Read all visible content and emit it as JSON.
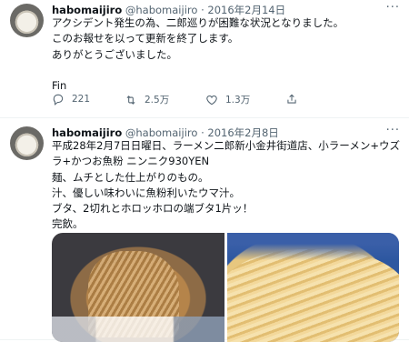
{
  "tweets": [
    {
      "name": "habomaijiro",
      "handle": "@habomaijiro",
      "dot": "·",
      "date": "2016年2月14日",
      "more": "···",
      "lines": [
        "アクシデント発生の為、二郎巡りが困難な状況となりました。",
        "このお報せを以って更新を終了します。",
        "ありがとうございました。",
        "",
        "Fin"
      ],
      "actions": {
        "replies": "221",
        "retweets": "2.5万",
        "likes": "1.3万"
      },
      "icons": {
        "reply": "reply-icon",
        "retweet": "retweet-icon",
        "like": "heart-icon",
        "share": "share-icon"
      }
    },
    {
      "name": "habomaijiro",
      "handle": "@habomaijiro",
      "dot": "·",
      "date": "2016年2月8日",
      "more": "···",
      "lines": [
        "平成28年2月7日日曜日、ラーメン二郎新小金井街道店、小ラーメン+ウズ",
        "ラ+かつお魚粉 ニンニク930YEN",
        "麺、ムチとした仕上がりのもの。",
        "汁、優しい味わいに魚粉利いたウマ汁。",
        "ブタ、2切れとホロッホロの端ブタ1片ッ！",
        "完飲。"
      ],
      "media": [
        "ramen-photo",
        "noodles-photo"
      ]
    }
  ],
  "colors": {
    "text": "#0f1419",
    "secondary": "#536471",
    "divider": "#eff3f4"
  }
}
